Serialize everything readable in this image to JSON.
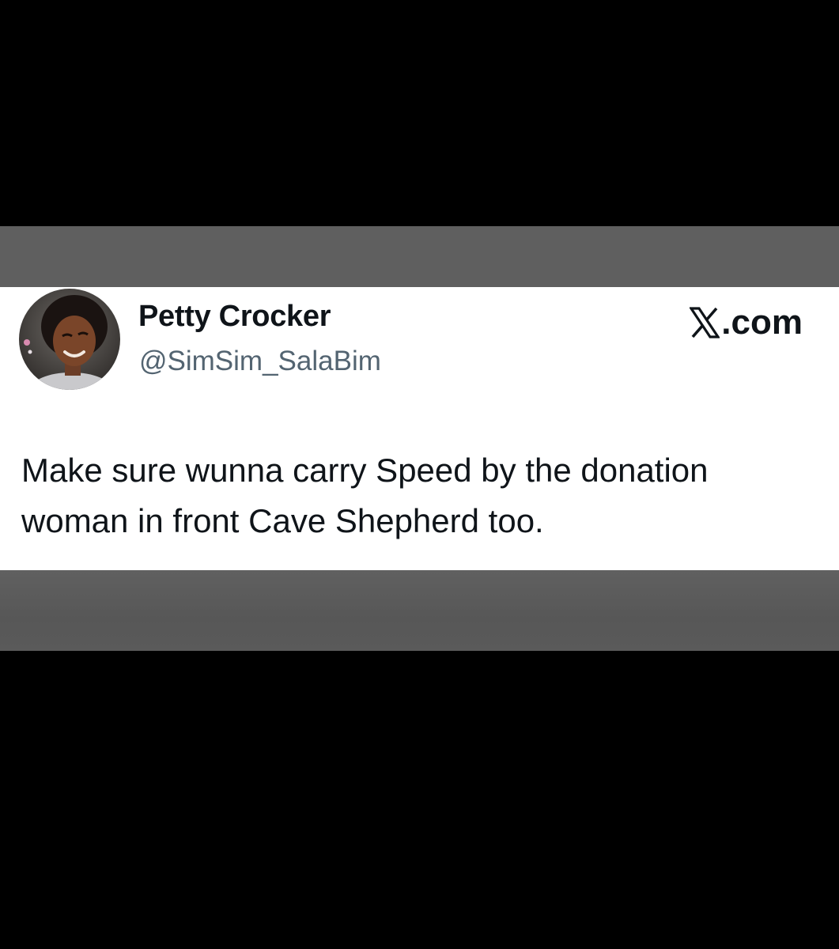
{
  "tweet": {
    "display_name": "Petty Crocker",
    "handle": "@SimSim_SalaBim",
    "text": "Make sure wunna carry Speed by the donation woman in front Cave Shepherd too."
  },
  "brand": {
    "label": ".com",
    "icon": "x-logo-icon"
  },
  "colors": {
    "background": "#000000",
    "band": "#5f5f5f",
    "card": "#ffffff",
    "text_primary": "#0f1419",
    "text_secondary": "#536471"
  }
}
